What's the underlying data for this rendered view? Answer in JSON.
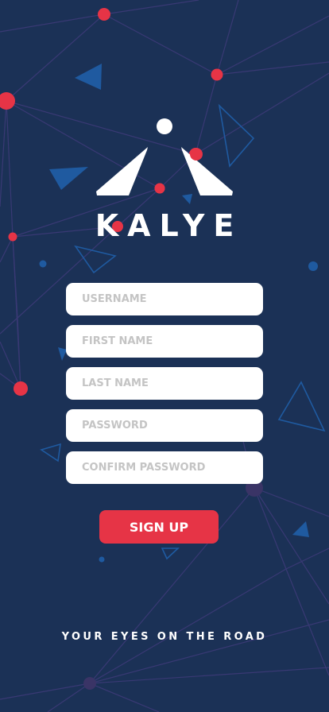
{
  "brand": {
    "name": "KALYE",
    "tagline": "YOUR EYES ON THE ROAD"
  },
  "form": {
    "username_placeholder": "USERNAME",
    "first_name_placeholder": "FIRST NAME",
    "last_name_placeholder": "LAST NAME",
    "password_placeholder": "PASSWORD",
    "confirm_password_placeholder": "CONFIRM PASSWORD",
    "signup_label": "SIGN UP"
  },
  "colors": {
    "background": "#1b3156",
    "accent_red": "#e63446",
    "network_blue": "#1f5aa0",
    "network_line": "#3d3a78",
    "field_background": "#ffffff",
    "placeholder": "#c4c4c4"
  },
  "icons": {
    "logo": "road-perspective-logo-icon"
  }
}
